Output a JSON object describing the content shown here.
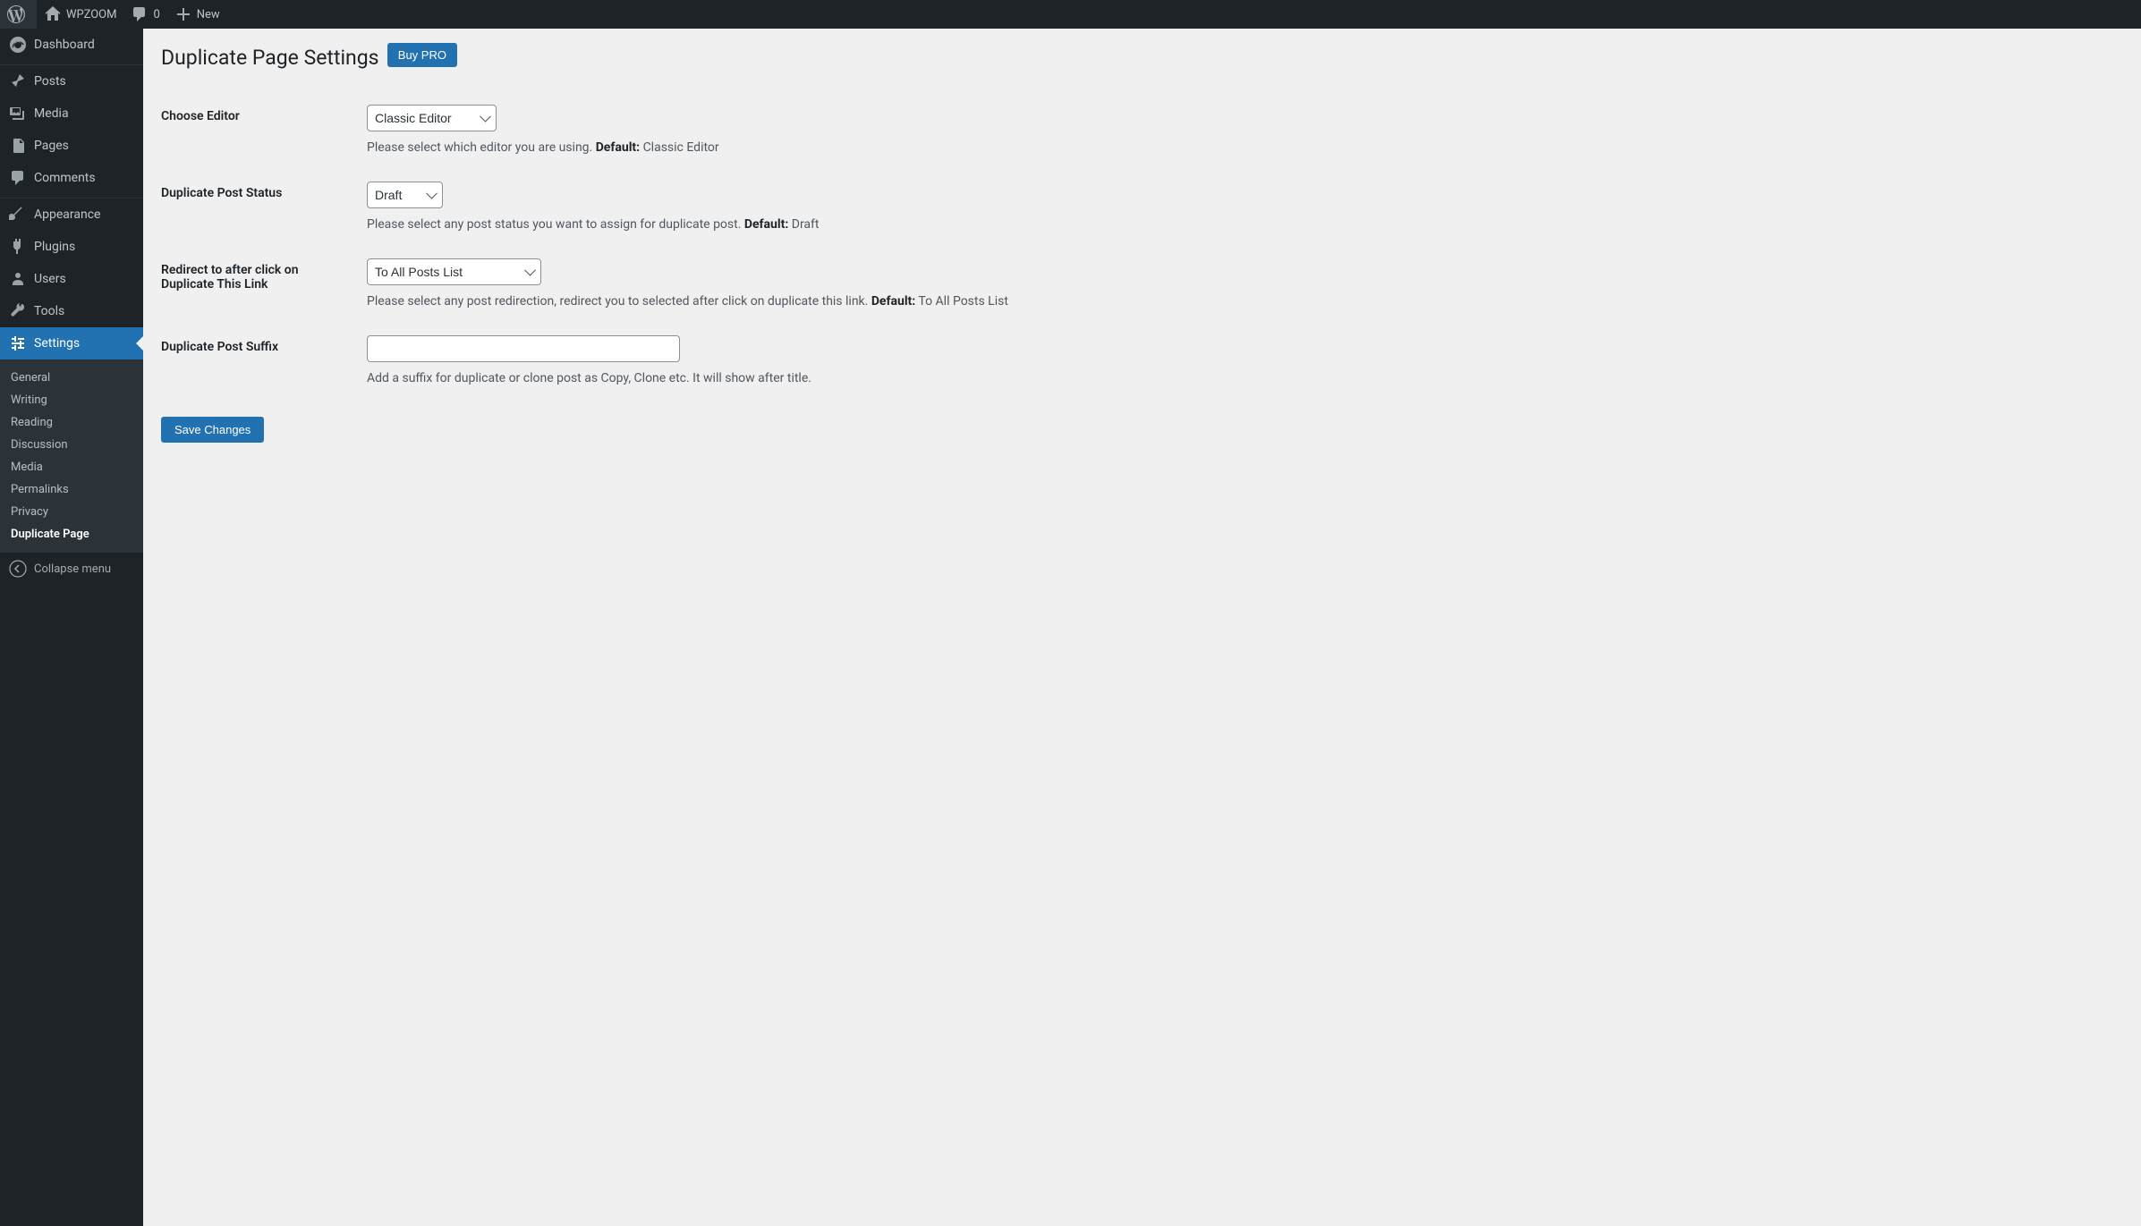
{
  "adminbar": {
    "site_name": "WPZOOM",
    "comments_count": "0",
    "new_label": "New"
  },
  "sidebar": {
    "items": [
      {
        "label": "Dashboard"
      },
      {
        "label": "Posts"
      },
      {
        "label": "Media"
      },
      {
        "label": "Pages"
      },
      {
        "label": "Comments"
      },
      {
        "label": "Appearance"
      },
      {
        "label": "Plugins"
      },
      {
        "label": "Users"
      },
      {
        "label": "Tools"
      },
      {
        "label": "Settings"
      }
    ],
    "submenu": [
      {
        "label": "General"
      },
      {
        "label": "Writing"
      },
      {
        "label": "Reading"
      },
      {
        "label": "Discussion"
      },
      {
        "label": "Media"
      },
      {
        "label": "Permalinks"
      },
      {
        "label": "Privacy"
      },
      {
        "label": "Duplicate Page"
      }
    ],
    "collapse_label": "Collapse menu"
  },
  "page": {
    "title": "Duplicate Page Settings",
    "buy_pro_label": "Buy PRO",
    "save_label": "Save Changes"
  },
  "fields": {
    "editor": {
      "label": "Choose Editor",
      "value": "Classic Editor",
      "description_pre": "Please select which editor you are using. ",
      "default_label": "Default:",
      "default_value": " Classic Editor"
    },
    "status": {
      "label": "Duplicate Post Status",
      "value": "Draft",
      "description_pre": "Please select any post status you want to assign for duplicate post. ",
      "default_label": "Default:",
      "default_value": " Draft"
    },
    "redirect": {
      "label": "Redirect to after click on Duplicate This Link",
      "value": "To All Posts List",
      "description_pre": "Please select any post redirection, redirect you to selected after click on duplicate this link. ",
      "default_label": "Default:",
      "default_value": " To All Posts List"
    },
    "suffix": {
      "label": "Duplicate Post Suffix",
      "value": "",
      "description": "Add a suffix for duplicate or clone post as Copy, Clone etc. It will show after title."
    }
  }
}
